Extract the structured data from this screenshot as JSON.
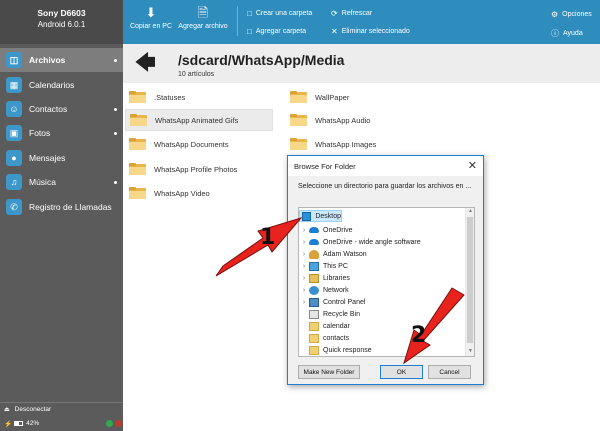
{
  "device": {
    "name": "Sony D6603",
    "os": "Android 6.0.1"
  },
  "sidebar": {
    "items": [
      {
        "label": "Archivos",
        "icon": "files-icon",
        "active": true,
        "dot": true
      },
      {
        "label": "Calendarios",
        "icon": "calendar-icon",
        "active": false,
        "dot": false
      },
      {
        "label": "Contactos",
        "icon": "contacts-icon",
        "active": false,
        "dot": true
      },
      {
        "label": "Fotos",
        "icon": "photos-icon",
        "active": false,
        "dot": true
      },
      {
        "label": "Mensajes",
        "icon": "messages-icon",
        "active": false,
        "dot": false
      },
      {
        "label": "Música",
        "icon": "music-icon",
        "active": false,
        "dot": true
      },
      {
        "label": "Registro de Llamadas",
        "icon": "phone-icon",
        "active": false,
        "dot": false
      }
    ],
    "disconnect_label": "Desconectar",
    "battery": "42%"
  },
  "toolbar": {
    "copy_pc": "Copiar en PC",
    "add_file": "Agregar archivo",
    "create_folder": "Crear una carpeta",
    "add_folder": "Agregar carpeta",
    "refresh": "Refrescar",
    "delete_selected": "Eliminar seleccionado",
    "options": "Opciones",
    "help": "Ayuda"
  },
  "path": {
    "title": "/sdcard/WhatsApp/Media",
    "count": "10 artículos"
  },
  "folders": [
    ".Statuses",
    "WallPaper",
    "WhatsApp Animated Gifs",
    "WhatsApp Audio",
    "WhatsApp Documents",
    "WhatsApp Images",
    "WhatsApp Profile Photos",
    "WhatsApp Video"
  ],
  "dialog": {
    "title": "Browse For Folder",
    "close": "✕",
    "description": "Seleccione un directorio para guardar los archivos en ...",
    "tree": [
      {
        "label": "Desktop",
        "icon": "desktop-icon"
      },
      {
        "label": "OneDrive",
        "icon": "cloud-icon"
      },
      {
        "label": "OneDrive - wide angle software",
        "icon": "cloud-icon"
      },
      {
        "label": "Adam Watson",
        "icon": "user-icon"
      },
      {
        "label": "This PC",
        "icon": "computer-icon"
      },
      {
        "label": "Libraries",
        "icon": "libraries-icon"
      },
      {
        "label": "Network",
        "icon": "network-icon"
      },
      {
        "label": "Control Panel",
        "icon": "control-panel-icon"
      },
      {
        "label": "Recycle Bin",
        "icon": "recycle-bin-icon"
      },
      {
        "label": "calendar",
        "icon": "folder-icon"
      },
      {
        "label": "contacts",
        "icon": "folder-icon"
      },
      {
        "label": "Quick response",
        "icon": "folder-icon"
      }
    ],
    "new_folder": "Make New Folder",
    "ok": "OK",
    "cancel": "Cancel"
  },
  "annotations": {
    "step1": "1",
    "step2": "2"
  },
  "colors": {
    "accent": "#2e8dbd",
    "sidebar": "#5b5b5b",
    "arrow": "#e8231d",
    "folder": "#f2c14e",
    "selection": "#cce8ff"
  }
}
